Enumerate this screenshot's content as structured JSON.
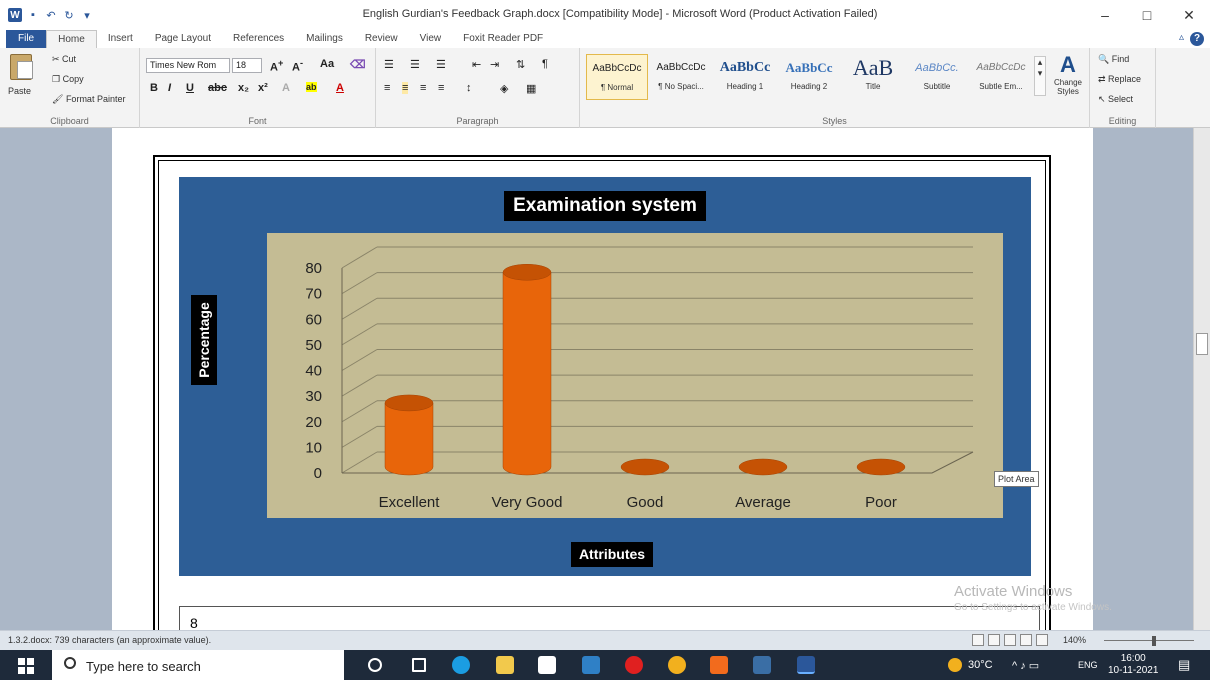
{
  "window": {
    "title": "English Gurdian's Feedback Graph.docx [Compatibility Mode] - Microsoft Word (Product Activation Failed)",
    "controls": [
      "–",
      "□",
      "✕"
    ]
  },
  "tabs": [
    "File",
    "Home",
    "Insert",
    "Page Layout",
    "References",
    "Mailings",
    "Review",
    "View",
    "Foxit Reader PDF"
  ],
  "active_tab": "Home",
  "ribbon": {
    "clipboard": {
      "paste": "Paste",
      "cut": "Cut",
      "copy": "Copy",
      "format_painter": "Format Painter",
      "label": "Clipboard"
    },
    "font": {
      "family": "Times New Rom",
      "size": "18",
      "label": "Font"
    },
    "paragraph": {
      "label": "Paragraph"
    },
    "styles": {
      "label": "Styles",
      "items": [
        {
          "preview": "AaBbCcDc",
          "name": "¶ Normal"
        },
        {
          "preview": "AaBbCcDc",
          "name": "¶ No Spaci..."
        },
        {
          "preview": "AaBbCc",
          "name": "Heading 1"
        },
        {
          "preview": "AaBbCc",
          "name": "Heading 2"
        },
        {
          "preview": "AaB",
          "name": "Title"
        },
        {
          "preview": "AaBbCc.",
          "name": "Subtitle"
        },
        {
          "preview": "AaBbCcDc",
          "name": "Subtle Em..."
        }
      ],
      "change_styles": "Change Styles"
    },
    "editing": {
      "find": "Find",
      "replace": "Replace",
      "select": "Select",
      "label": "Editing"
    }
  },
  "chart": {
    "title": "Examination system",
    "ylabel": "Percentage",
    "xlabel": "Attributes",
    "tooltip": "Plot Area"
  },
  "chart_data": {
    "type": "bar",
    "title": "Examination system",
    "xlabel": "Attributes",
    "ylabel": "Percentage",
    "categories": [
      "Excellent",
      "Very Good",
      "Good",
      "Average",
      "Poor"
    ],
    "values": [
      25,
      76,
      0,
      0,
      0
    ],
    "yticks": [
      0,
      10,
      20,
      30,
      40,
      50,
      60,
      70,
      80
    ],
    "ylim": [
      0,
      80
    ],
    "grid": true,
    "colors": {
      "bar": "#e8650a",
      "bar_top": "#c55204",
      "plot_bg": "#c4bc94",
      "chart_bg": "#2d5e96"
    }
  },
  "document": {
    "next_page_text": "8"
  },
  "watermark": {
    "line1": "Activate Windows",
    "line2": "Go to Settings to activate Windows."
  },
  "statusbar": {
    "left": "1.3.2.docx: 739 characters (an approximate value).",
    "zoom": "140%"
  },
  "taskbar": {
    "search_placeholder": "Type here to search",
    "temperature": "30°C",
    "language": "ENG",
    "time": "16:00",
    "date": "10-11-2021"
  }
}
